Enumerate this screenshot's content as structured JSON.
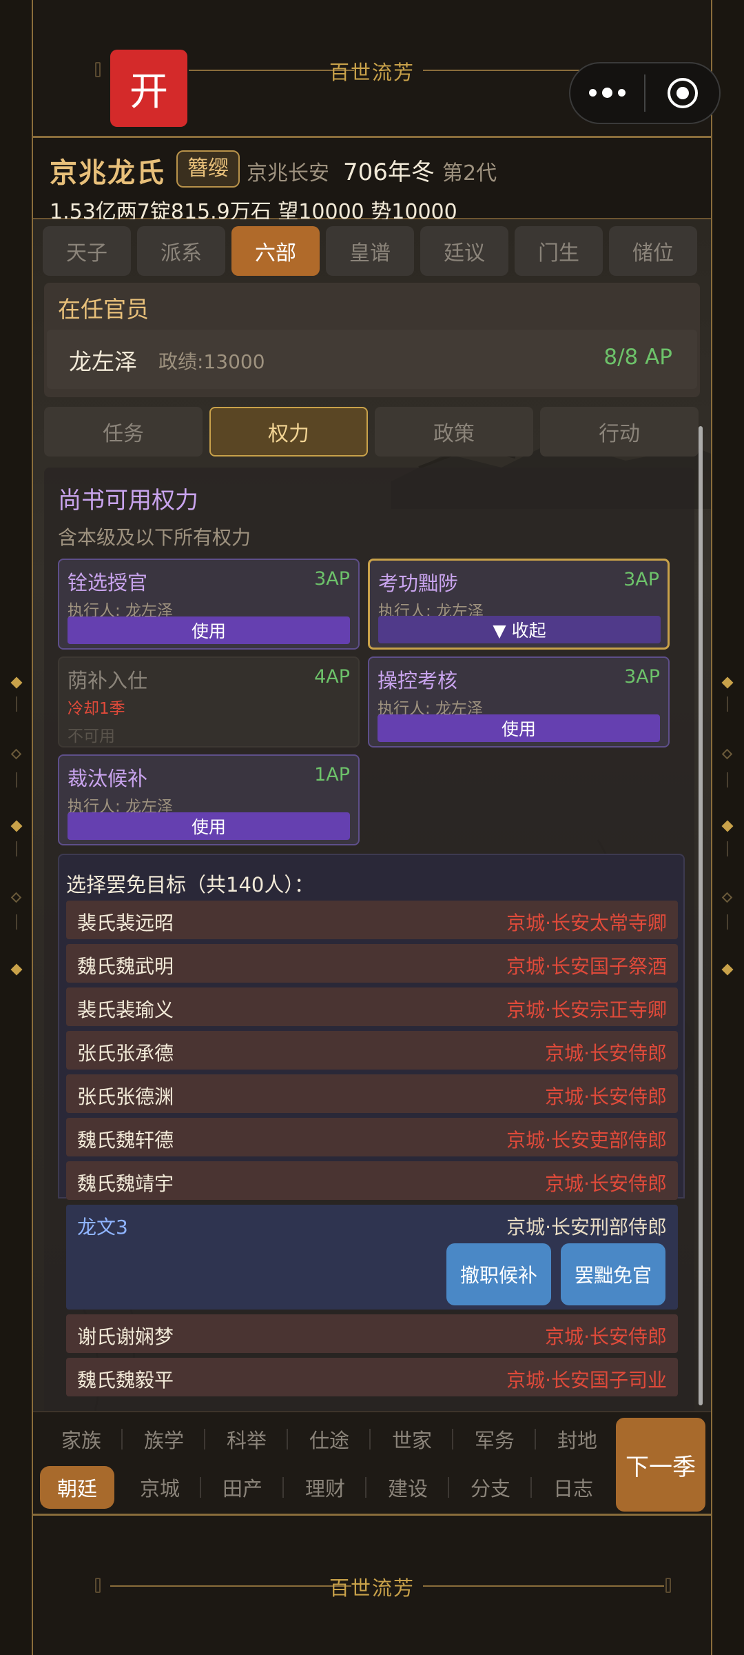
{
  "banner": {
    "open_label": "开",
    "title": "百世流芳"
  },
  "family": {
    "name": "京兆龙氏",
    "badge": "簪缨",
    "location": "京兆长安",
    "year": "706年冬",
    "generation": "第2代",
    "stats": "1.53亿两7锭815.9万石  望10000  势10000"
  },
  "top_tabs": [
    {
      "label": "天子"
    },
    {
      "label": "派系"
    },
    {
      "label": "六部",
      "active": true
    },
    {
      "label": "皇谱"
    },
    {
      "label": "廷议"
    },
    {
      "label": "门生"
    },
    {
      "label": "储位"
    }
  ],
  "officials": {
    "title": "在任官员",
    "name": "龙左泽",
    "merit": "政绩:13000",
    "ap": "8/8 AP"
  },
  "sub_tabs": [
    {
      "label": "任务"
    },
    {
      "label": "权力",
      "active": true
    },
    {
      "label": "政策"
    },
    {
      "label": "行动"
    }
  ],
  "power": {
    "title": "尚书可用权力",
    "subtitle": "含本级及以下所有权力",
    "cards": [
      {
        "name": "铨选授官",
        "ap": "3AP",
        "exec": "执行人: 龙左泽",
        "button": "使用"
      },
      {
        "name": "考功黜陟",
        "ap": "3AP",
        "exec": "执行人: 龙左泽",
        "button": "▼ 收起"
      },
      {
        "name": "荫补入仕",
        "ap": "4AP",
        "cooldown": "冷却1季",
        "na": "不可用"
      },
      {
        "name": "操控考核",
        "ap": "3AP",
        "exec": "执行人: 龙左泽",
        "button": "使用"
      },
      {
        "name": "裁汰候补",
        "ap": "1AP",
        "exec": "执行人: 龙左泽",
        "button": "使用"
      }
    ]
  },
  "targets": {
    "title": "选择罢免目标（共140人）：",
    "rows": [
      {
        "name": "裴氏裴远昭",
        "loc": "京城·长安太常寺卿"
      },
      {
        "name": "魏氏魏武明",
        "loc": "京城·长安国子祭酒"
      },
      {
        "name": "裴氏裴瑜义",
        "loc": "京城·长安宗正寺卿"
      },
      {
        "name": "张氏张承德",
        "loc": "京城·长安侍郎"
      },
      {
        "name": "张氏张德渊",
        "loc": "京城·长安侍郎"
      },
      {
        "name": "魏氏魏轩德",
        "loc": "京城·长安吏部侍郎"
      },
      {
        "name": "魏氏魏靖宇",
        "loc": "京城·长安侍郎"
      },
      {
        "name": "龙文3",
        "loc": "京城·长安刑部侍郎",
        "btn1": "撤职候补",
        "btn2": "罢黜免官"
      },
      {
        "name": "谢氏谢娴梦",
        "loc": "京城·长安侍郎"
      },
      {
        "name": "魏氏魏毅平",
        "loc": "京城·长安国子司业"
      }
    ]
  },
  "bottom_nav": {
    "row1": [
      "家族",
      "族学",
      "科举",
      "仕途",
      "世家",
      "军务",
      "封地"
    ],
    "row2": [
      "朝廷",
      "京城",
      "田产",
      "理财",
      "建设",
      "分支",
      "日志"
    ],
    "active": "朝廷",
    "next": "下一季"
  }
}
